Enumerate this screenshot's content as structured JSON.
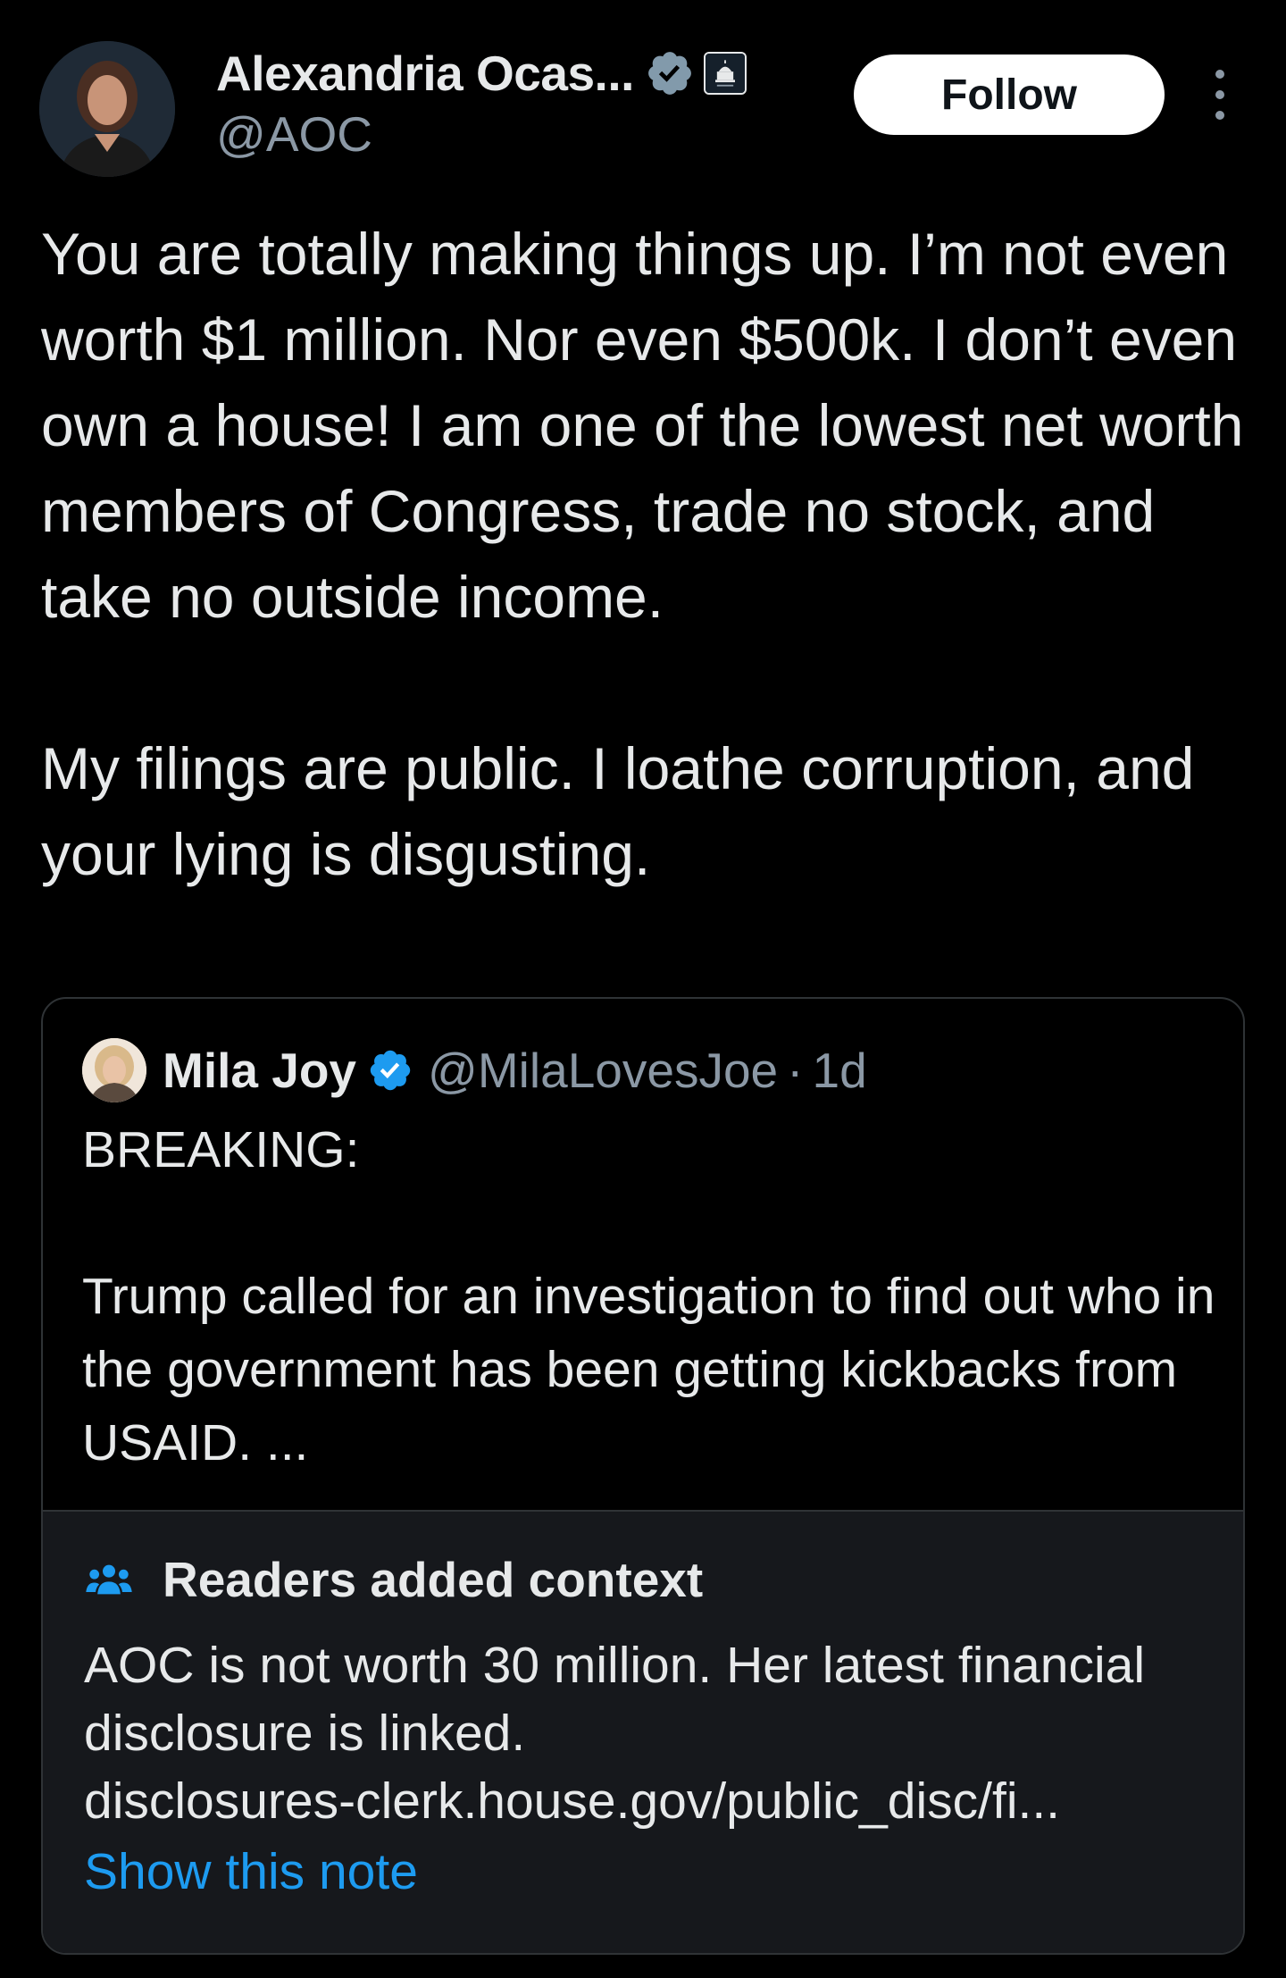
{
  "author": {
    "display_name": "Alexandria Ocas...",
    "handle": "@AOC",
    "avatar_icon": "avatar-photo",
    "verified_icon": "verified-badge-icon",
    "affiliation_icon": "capitol-badge-icon"
  },
  "actions": {
    "follow_label": "Follow",
    "more_icon": "more-vertical-icon"
  },
  "tweet": {
    "paragraph_1": "You are totally making things up. I’m not even worth $1 million. Nor even $500k. I don’t even own a house! I am one of the lowest net worth members of Congress, trade no stock, and take no outside income.",
    "paragraph_2": "My filings are public. I loathe corruption, and your lying is disgusting."
  },
  "quote": {
    "display_name": "Mila Joy",
    "handle": "@MilaLovesJoe",
    "separator": "·",
    "time": "1d",
    "paragraph_1": "BREAKING:",
    "paragraph_2": "Trump called for an investigation to find out who in the government has been getting kickbacks from USAID. ..."
  },
  "context": {
    "title": "Readers added context",
    "line_1": "AOC is not worth 30 million. Her latest financial",
    "line_2": "disclosure is linked.",
    "line_3": "disclosures-clerk.house.gov/public_disc/fi...",
    "show_note_label": "Show this note"
  },
  "colors": {
    "background": "#000000",
    "text_primary": "#e7e9ea",
    "text_secondary": "#8b98a5",
    "accent_blue": "#1d9bf0",
    "context_background": "#16181c",
    "border": "#2f3336"
  }
}
